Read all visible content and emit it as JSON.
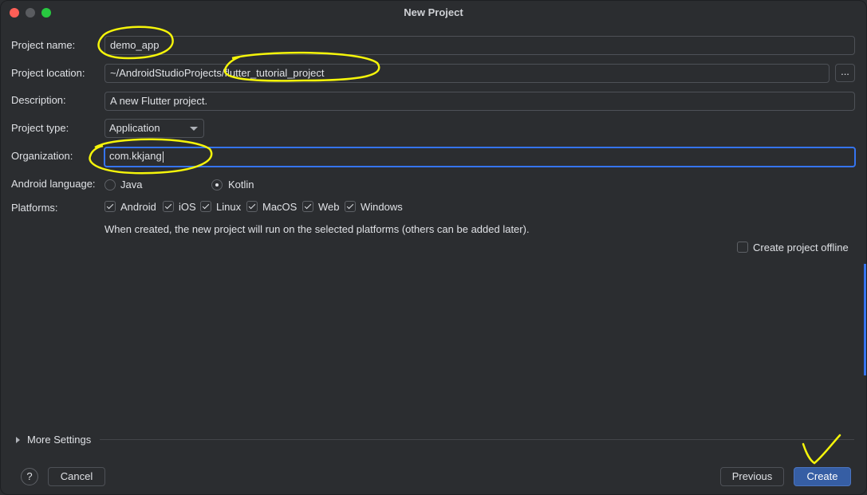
{
  "window": {
    "title": "New Project"
  },
  "form": {
    "project_name": {
      "label": "Project name:",
      "value": "demo_app"
    },
    "project_location": {
      "label": "Project location:",
      "value": "~/AndroidStudioProjects/flutter_tutorial_project",
      "browse_label": "..."
    },
    "description": {
      "label": "Description:",
      "value": "A new Flutter project."
    },
    "project_type": {
      "label": "Project type:",
      "selected": "Application"
    },
    "organization": {
      "label": "Organization:",
      "value": "com.kkjang"
    },
    "android_language": {
      "label": "Android language:",
      "options": [
        {
          "label": "Java",
          "selected": false
        },
        {
          "label": "Kotlin",
          "selected": true
        }
      ]
    },
    "platforms": {
      "label": "Platforms:",
      "options": [
        {
          "label": "Android",
          "checked": true
        },
        {
          "label": "iOS",
          "checked": true
        },
        {
          "label": "Linux",
          "checked": true
        },
        {
          "label": "MacOS",
          "checked": true
        },
        {
          "label": "Web",
          "checked": true
        },
        {
          "label": "Windows",
          "checked": true
        }
      ],
      "hint": "When created, the new project will run on the selected platforms (others can be added later)."
    },
    "create_offline": {
      "label": "Create project offline",
      "checked": false
    }
  },
  "more_settings": {
    "label": "More Settings"
  },
  "footer": {
    "help_label": "?",
    "cancel_label": "Cancel",
    "previous_label": "Previous",
    "create_label": "Create"
  },
  "colors": {
    "accent": "#3574f0",
    "annotation": "#f5f50a",
    "background": "#2b2d30"
  }
}
